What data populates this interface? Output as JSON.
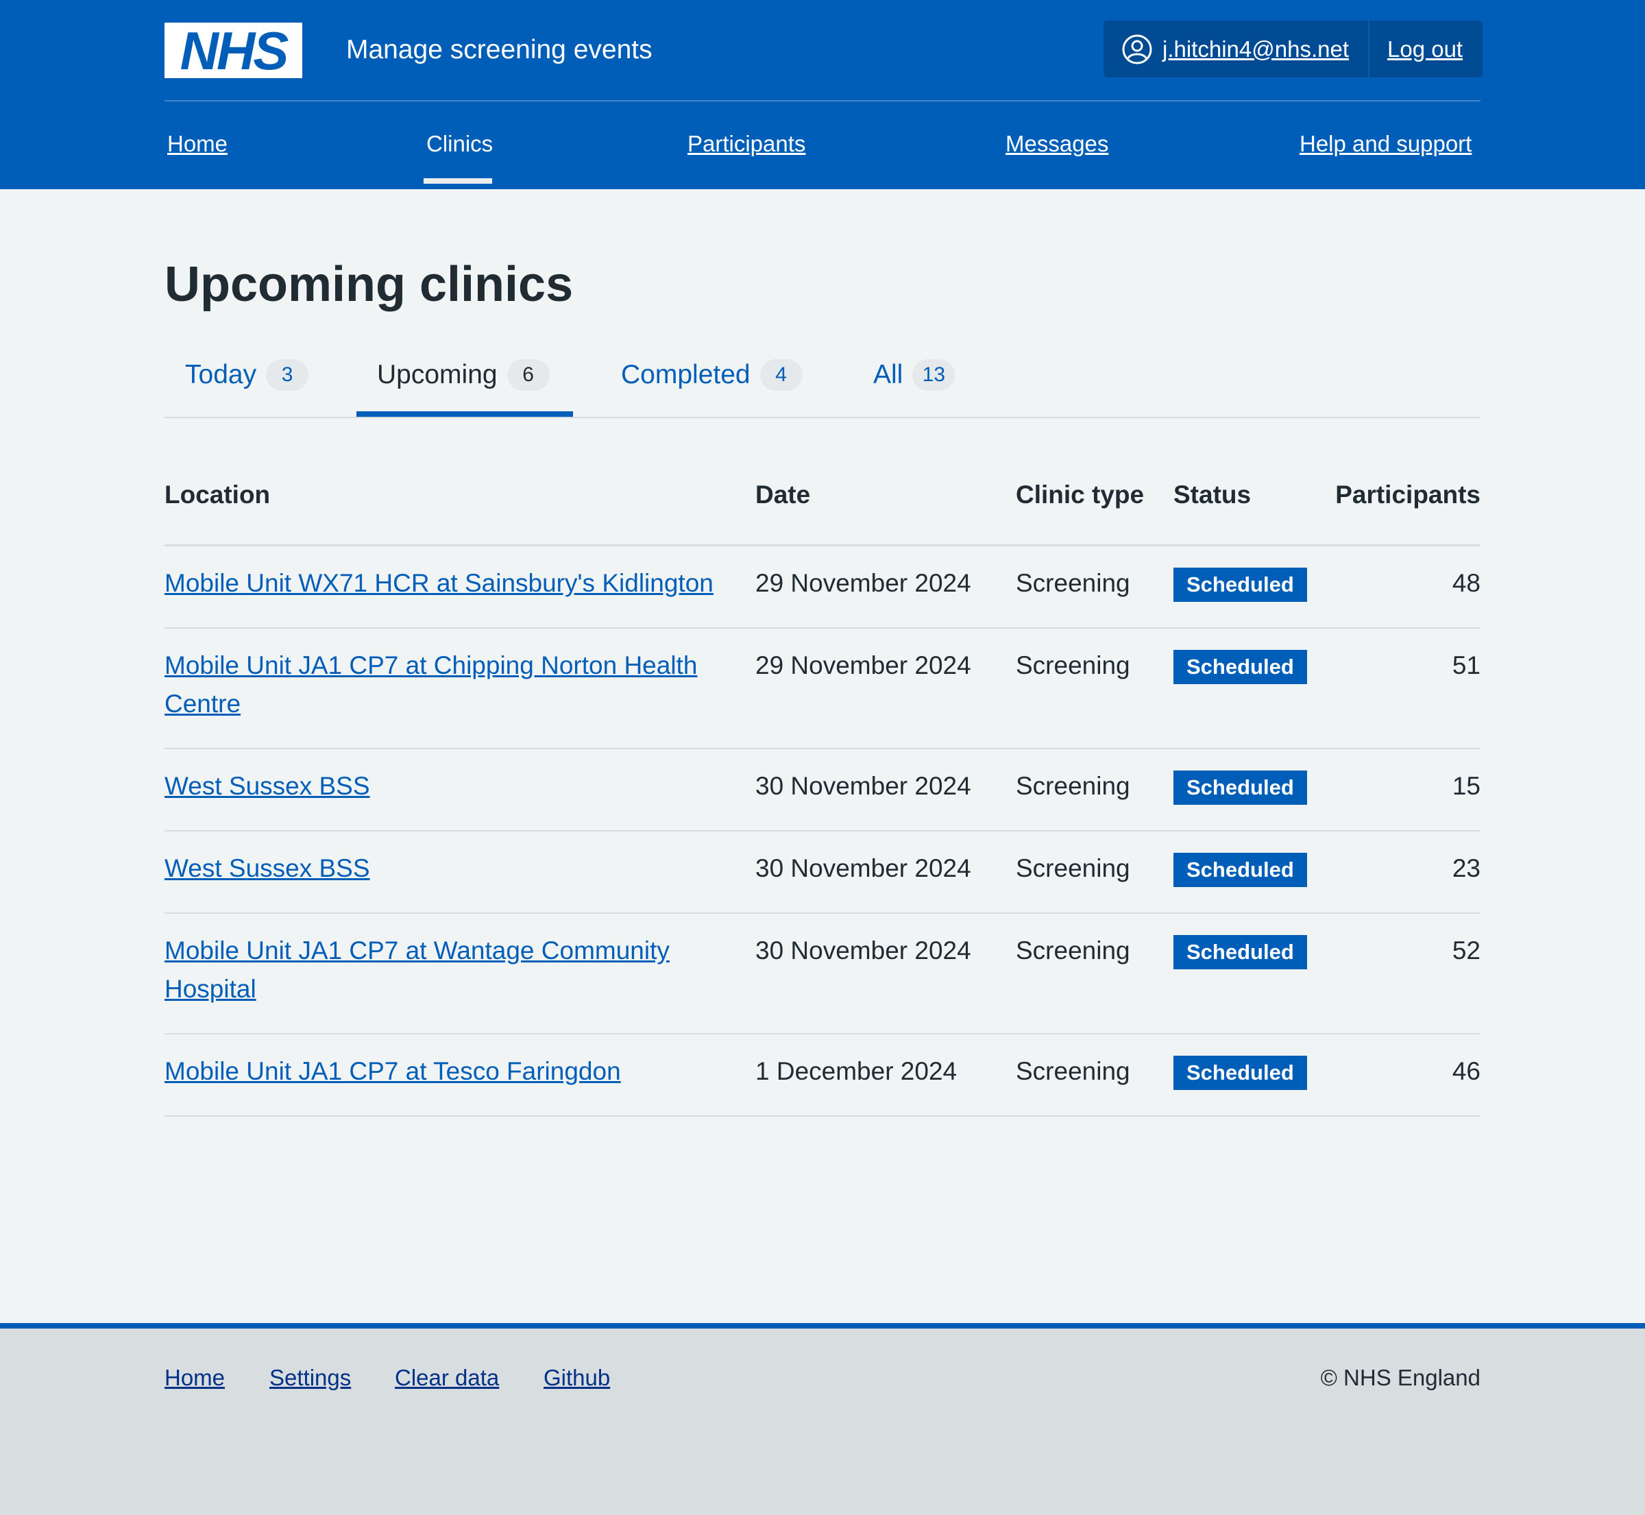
{
  "header": {
    "logo_text": "NHS",
    "service_name": "Manage screening events",
    "account": {
      "user_icon": "user-circle-icon",
      "email": "j.hitchin4@nhs.net",
      "logout": "Log out"
    }
  },
  "nav": {
    "items": [
      {
        "label": "Home"
      },
      {
        "label": "Clinics",
        "active": true
      },
      {
        "label": "Participants"
      },
      {
        "label": "Messages"
      },
      {
        "label": "Help and support"
      }
    ]
  },
  "main": {
    "title": "Upcoming clinics",
    "tabs": [
      {
        "label": "Today",
        "count": "3"
      },
      {
        "label": "Upcoming",
        "count": "6",
        "active": true
      },
      {
        "label": "Completed",
        "count": "4"
      },
      {
        "label": "All",
        "count": "13"
      }
    ],
    "table": {
      "headers": {
        "location": "Location",
        "date": "Date",
        "clinic_type": "Clinic type",
        "status": "Status",
        "participants": "Participants"
      },
      "rows": [
        {
          "location": "Mobile Unit WX71 HCR at Sainsbury's Kidlington",
          "date": "29 November 2024",
          "clinic_type": "Screening",
          "status": "Scheduled",
          "participants": "48"
        },
        {
          "location": "Mobile Unit JA1 CP7 at Chipping Norton Health Centre",
          "date": "29 November 2024",
          "clinic_type": "Screening",
          "status": "Scheduled",
          "participants": "51"
        },
        {
          "location": "West Sussex BSS",
          "date": "30 November 2024",
          "clinic_type": "Screening",
          "status": "Scheduled",
          "participants": "15"
        },
        {
          "location": "West Sussex BSS",
          "date": "30 November 2024",
          "clinic_type": "Screening",
          "status": "Scheduled",
          "participants": "23"
        },
        {
          "location": "Mobile Unit JA1 CP7 at Wantage Community Hospital",
          "date": "30 November 2024",
          "clinic_type": "Screening",
          "status": "Scheduled",
          "participants": "52"
        },
        {
          "location": "Mobile Unit JA1 CP7 at Tesco Faringdon",
          "date": "1 December 2024",
          "clinic_type": "Screening",
          "status": "Scheduled",
          "participants": "46"
        }
      ]
    }
  },
  "footer": {
    "links": [
      {
        "label": "Home"
      },
      {
        "label": "Settings"
      },
      {
        "label": "Clear data"
      },
      {
        "label": "Github"
      }
    ],
    "copyright": "© NHS England"
  },
  "colors": {
    "brand_blue": "#005eb8",
    "dark_blue": "#003087",
    "page_background": "#f0f4f5",
    "footer_background": "#d8dde0",
    "text": "#212b32"
  }
}
